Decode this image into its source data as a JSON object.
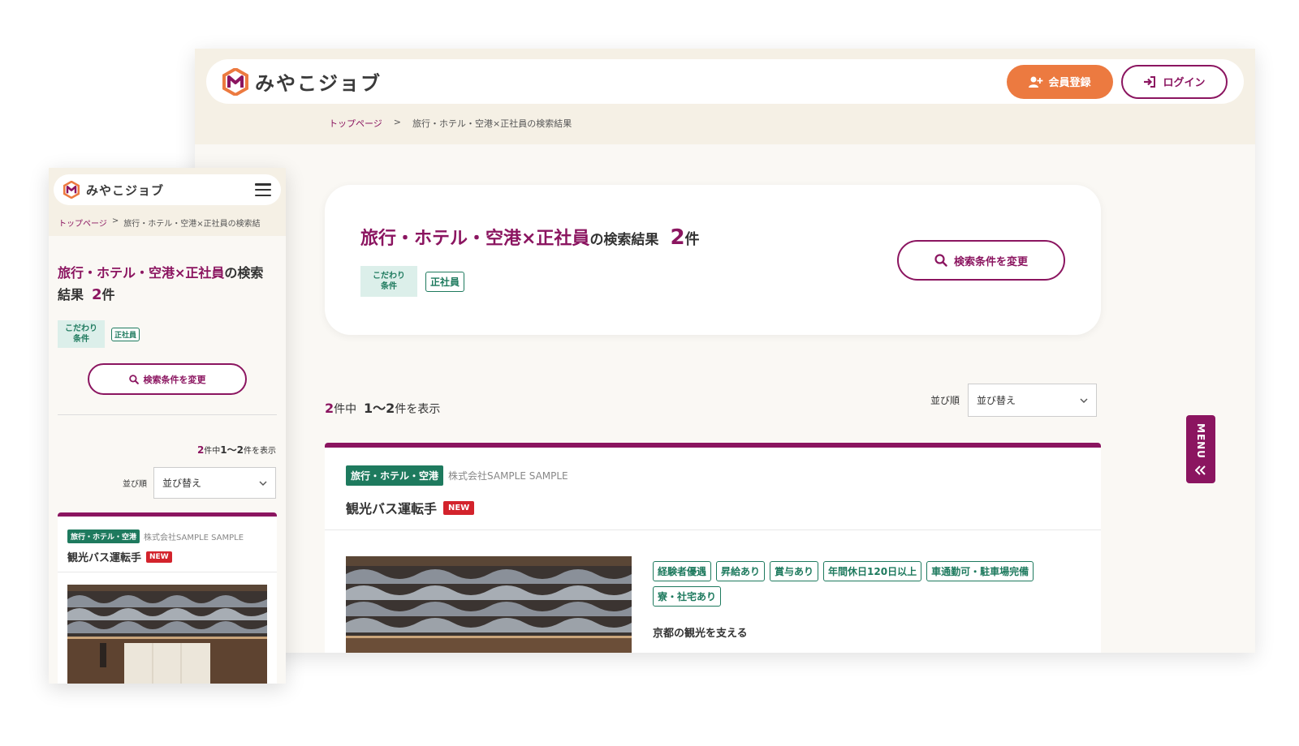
{
  "brand": {
    "name": "みやこジョブ",
    "colors": {
      "primary": "#8b1560",
      "accent": "#ec7a40",
      "green": "#1e7a5e",
      "new": "#d3232c"
    }
  },
  "header": {
    "register_label": "会員登録",
    "login_label": "ログイン"
  },
  "breadcrumb": {
    "home": "トップページ",
    "separator": ">",
    "current": "旅行・ホテル・空港×正社員の検索結果",
    "current_short": "旅行・ホテル・空港×正社員の検索結"
  },
  "result": {
    "query": "旅行・ホテル・空港×正社員",
    "suffix": "の検索結果",
    "count": "2",
    "unit": "件",
    "mobile_suffix_1": "の検索",
    "mobile_suffix_2": "結果",
    "condition_label_1": "こだわり",
    "condition_label_2": "条件",
    "condition_tag": "正社員",
    "change_button": "検索条件を変更"
  },
  "listing": {
    "total": "2",
    "total_unit": "件中",
    "range": "1〜2",
    "range_unit": "件を表示",
    "sort_label": "並び順",
    "sort_value": "並び替え"
  },
  "job": {
    "category": "旅行・ホテル・空港",
    "company": "株式会社SAMPLE SAMPLE",
    "title": "観光バス運転手",
    "new_label": "NEW",
    "tags": [
      "経験者優遇",
      "昇給あり",
      "賞与あり",
      "年間休日120日以上",
      "車通勤可・駐車場完備",
      "寮・社宅あり"
    ],
    "catch": "京都の観光を支える"
  },
  "menu": {
    "label": "MENU"
  }
}
